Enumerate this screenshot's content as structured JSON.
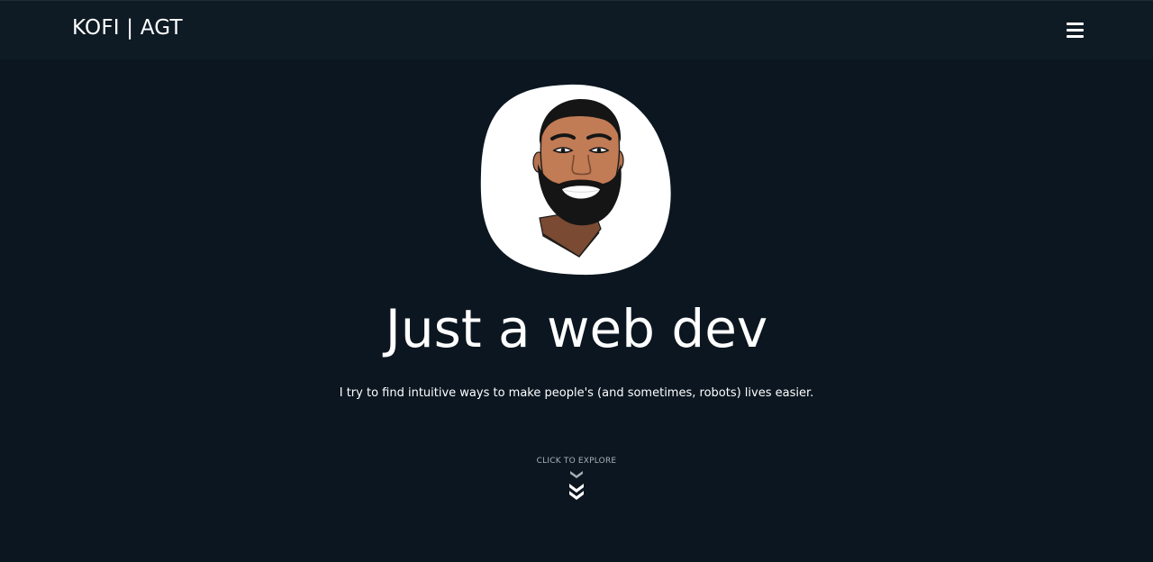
{
  "header": {
    "brand": "KOFI | AGT",
    "menu_icon": "hamburger-menu-icon"
  },
  "hero": {
    "avatar_icon": "cartoon-portrait-avatar",
    "headline": "Just a web dev",
    "subtitle": "I try to find intuitive ways to make people's (and sometimes, robots) lives easier.",
    "explore_label": "CLICK TO EXPLORE",
    "explore_icon": "double-chevron-down-icon"
  },
  "colors": {
    "background": "#0b1620",
    "navbar": "#0e1a24",
    "text": "#ffffff",
    "muted_text": "#a9b0b6"
  }
}
